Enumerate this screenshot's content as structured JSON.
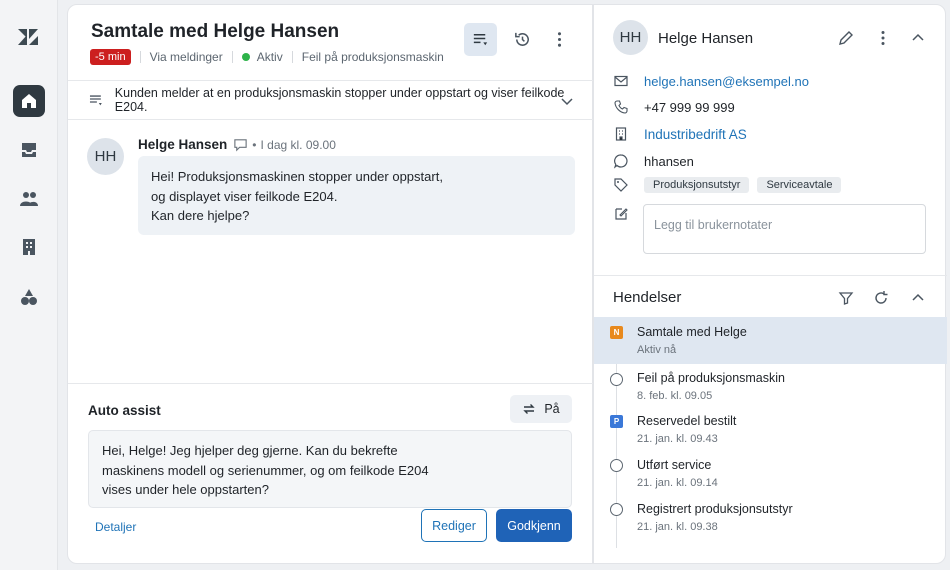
{
  "conversation": {
    "title": "Samtale med Helge Hansen",
    "sla_badge": "-5 min",
    "channel": "Via meldinger",
    "status": "Aktiv",
    "subject": "Feil på produksjonsmaskin",
    "summary": "Kunden melder at en produksjonsmaskin stopper under oppstart og viser feilkode E204."
  },
  "message": {
    "avatar_initials": "HH",
    "author": "Helge Hansen",
    "time": "I dag kl. 09.00",
    "lines": [
      "Hei! Produksjonsmaskinen stopper under oppstart,",
      "og displayet viser feilkode E204.",
      "Kan dere hjelpe?"
    ]
  },
  "auto_assist": {
    "title": "Auto assist",
    "toggle_label": "På",
    "lines": [
      "Hei, Helge! Jeg hjelper deg gjerne. Kan du bekrefte",
      "maskinens modell og serienummer, og om feilkode E204",
      "vises under hele oppstarten?"
    ],
    "details_link": "Detaljer",
    "edit_label": "Rediger",
    "approve_label": "Godkjenn"
  },
  "customer": {
    "avatar_initials": "HH",
    "name": "Helge Hansen",
    "email": "helge.hansen@eksempel.no",
    "phone": "+47 999 99 999",
    "company": "Industribedrift AS",
    "whatsapp": "hhansen",
    "tags": [
      "Produksjonsutstyr",
      "Serviceavtale"
    ],
    "notes_placeholder": "Legg til brukernotater"
  },
  "events": {
    "title": "Hendelser",
    "items": [
      {
        "title": "Samtale med Helge",
        "date": "Aktiv nå",
        "marker": "N",
        "marker_color": "#e8891d"
      },
      {
        "title": "Feil på produksjonsmaskin",
        "date": "8. feb. kl. 09.05",
        "marker": "",
        "marker_color": ""
      },
      {
        "title": "Reservedel bestilt",
        "date": "21. jan. kl. 09.43",
        "marker": "P",
        "marker_color": "#3a78d8"
      },
      {
        "title": "Utført service",
        "date": "21. jan. kl. 09.14",
        "marker": "",
        "marker_color": ""
      },
      {
        "title": "Registrert produksjonsutstyr",
        "date": "21. jan. kl. 09.38",
        "marker": "",
        "marker_color": ""
      }
    ]
  },
  "colors": {
    "accent": "#1f73b7",
    "primary_button": "#1f63b7",
    "sla_red": "#cc1f1f",
    "active_green": "#2eb34a",
    "rail_active": "#2f3941"
  },
  "icons": {
    "rail": [
      "zendesk-logo-icon",
      "home-icon",
      "inbox-icon",
      "users-icon",
      "building-icon",
      "shapes-icon"
    ]
  }
}
